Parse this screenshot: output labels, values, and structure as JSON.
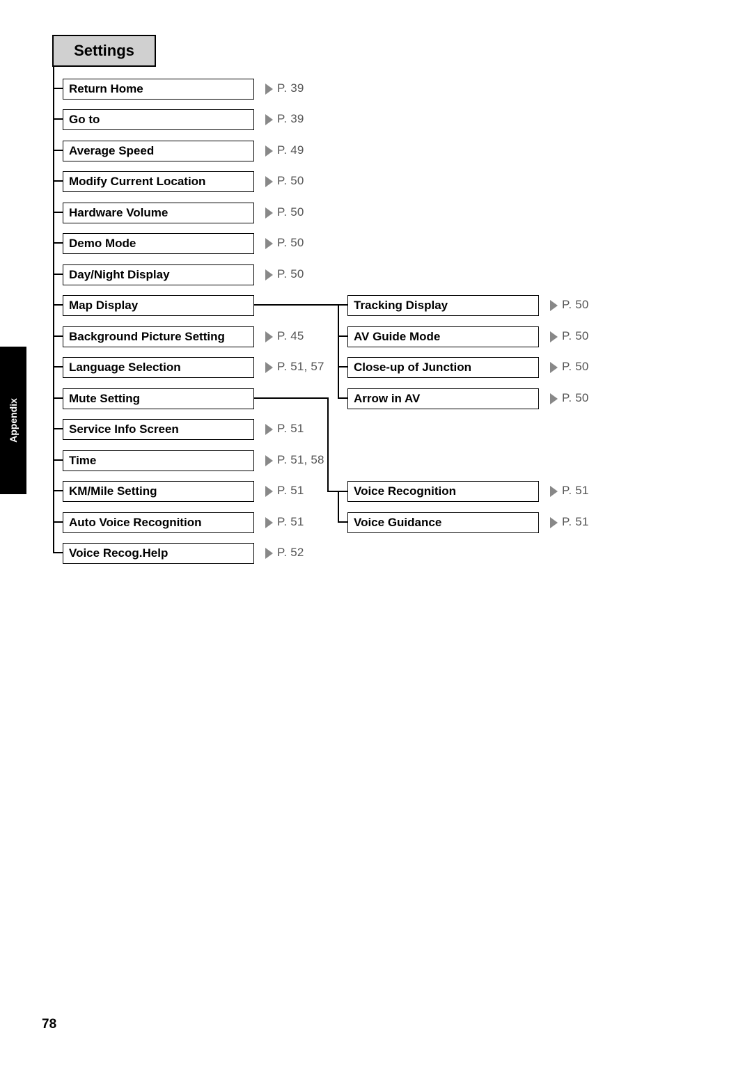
{
  "header": "Settings",
  "side_tab": "Appendix",
  "page_number": "78",
  "left_items": [
    {
      "label": "Return Home",
      "page": "P. 39"
    },
    {
      "label": "Go to",
      "page": "P. 39"
    },
    {
      "label": "Average Speed",
      "page": "P. 49"
    },
    {
      "label": "Modify Current Location",
      "page": "P. 50"
    },
    {
      "label": "Hardware Volume",
      "page": "P. 50"
    },
    {
      "label": "Demo Mode",
      "page": "P. 50"
    },
    {
      "label": "Day/Night Display",
      "page": "P. 50"
    },
    {
      "label": "Map Display",
      "page": ""
    },
    {
      "label": "Background Picture Setting",
      "page": "P. 45"
    },
    {
      "label": "Language Selection",
      "page": "P. 51, 57"
    },
    {
      "label": "Mute Setting",
      "page": ""
    },
    {
      "label": "Service Info Screen",
      "page": "P. 51"
    },
    {
      "label": "Time",
      "page": "P. 51, 58"
    },
    {
      "label": "KM/Mile Setting",
      "page": "P. 51"
    },
    {
      "label": "Auto Voice Recognition",
      "page": "P. 51"
    },
    {
      "label": "Voice Recog.Help",
      "page": "P. 52"
    }
  ],
  "map_sub": [
    {
      "label": "Tracking Display",
      "page": "P. 50"
    },
    {
      "label": "AV Guide Mode",
      "page": "P. 50"
    },
    {
      "label": "Close-up of Junction",
      "page": "P. 50"
    },
    {
      "label": "Arrow in AV",
      "page": "P. 50"
    }
  ],
  "mute_sub": [
    {
      "label": "Voice Recognition",
      "page": "P. 51"
    },
    {
      "label": "Voice Guidance",
      "page": "P. 51"
    }
  ]
}
